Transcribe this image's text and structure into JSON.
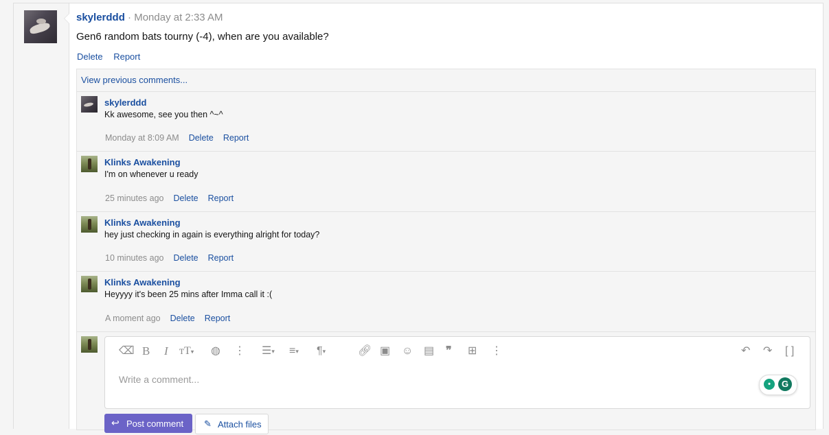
{
  "post": {
    "username": "skylerddd",
    "separator": "·",
    "time": "Monday at 2:33 AM",
    "body": "Gen6 random bats tourny (-4), when are you available?",
    "delete_label": "Delete",
    "report_label": "Report"
  },
  "comments_section": {
    "view_previous": "View previous comments...",
    "items": [
      {
        "username": "skylerddd",
        "text": "Kk awesome, see you then ^~^",
        "time": "Monday at 8:09 AM",
        "delete_label": "Delete",
        "report_label": "Report",
        "avatar": "skylerddd"
      },
      {
        "username": "Klinks Awakening",
        "text": "I'm on whenever u ready",
        "time": "25 minutes ago",
        "delete_label": "Delete",
        "report_label": "Report",
        "avatar": "klinks"
      },
      {
        "username": "Klinks Awakening",
        "text": "hey just checking in again is everything alright for today?",
        "time": "10 minutes ago",
        "delete_label": "Delete",
        "report_label": "Report",
        "avatar": "klinks"
      },
      {
        "username": "Klinks Awakening",
        "text": "Heyyyy it's been 25 mins after Imma call it :(",
        "time": "A moment ago",
        "delete_label": "Delete",
        "report_label": "Report",
        "avatar": "klinks"
      }
    ]
  },
  "editor": {
    "placeholder": "Write a comment...",
    "toolbar_icons": [
      "eraser-icon",
      "bold-icon",
      "italic-icon",
      "text-size-icon",
      "palette-icon",
      "more-icon",
      "list-icon",
      "align-icon",
      "paragraph-icon",
      "link-icon",
      "image-icon",
      "smiley-icon",
      "media-icon",
      "quote-icon",
      "table-icon",
      "more-icon",
      "undo-icon",
      "redo-icon",
      "brackets-icon"
    ]
  },
  "buttons": {
    "post_comment": "Post comment",
    "attach_files": "Attach files"
  },
  "colors": {
    "link": "#1a4fa0",
    "post_button": "#6b63c7",
    "grammarly": "#15a37f"
  }
}
